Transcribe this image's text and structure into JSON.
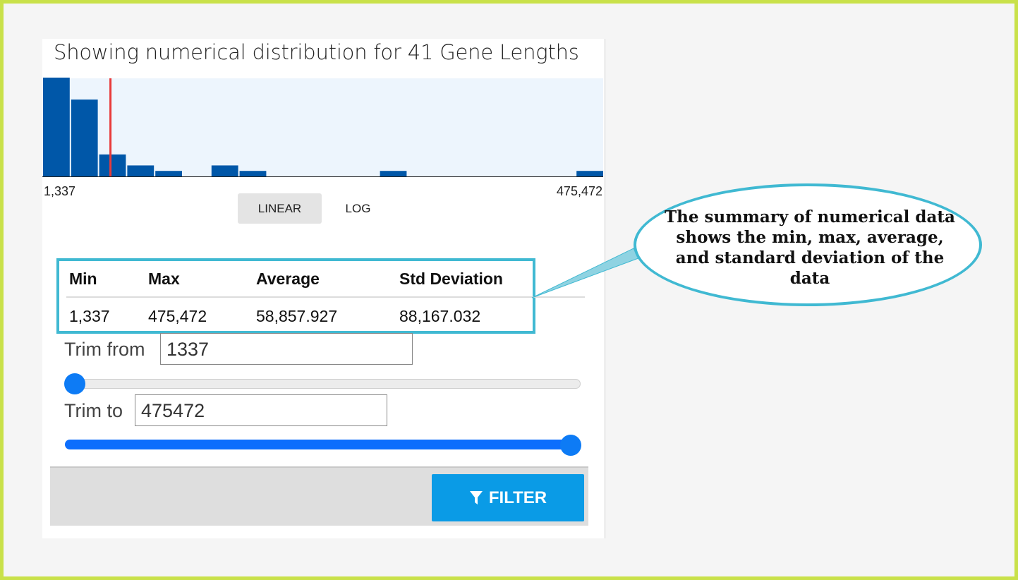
{
  "title": "Showing numerical distribution for 41 Gene Lengths",
  "chart_data": {
    "type": "bar",
    "title": "Showing numerical distribution for 41 Gene Lengths",
    "x_range": [
      1337,
      475472
    ],
    "x_min_label": "1,337",
    "x_max_label": "475,472",
    "bins": 20,
    "counts": [
      18,
      14,
      4,
      2,
      1,
      0,
      2,
      1,
      0,
      0,
      0,
      0,
      1,
      0,
      0,
      0,
      0,
      0,
      0,
      1
    ],
    "marker_value": 58857.927,
    "marker_label": "Average",
    "scale": "linear",
    "colors": {
      "bar": "#0057a8",
      "background": "#edf5fd",
      "marker": "#e83a3a"
    }
  },
  "scale_toggle": {
    "linear_label": "LINEAR",
    "log_label": "LOG",
    "selected": "LINEAR"
  },
  "stats": {
    "headers": {
      "min": "Min",
      "max": "Max",
      "average": "Average",
      "std": "Std Deviation"
    },
    "values": {
      "min": "1,337",
      "max": "475,472",
      "average": "58,857.927",
      "std": "88,167.032"
    }
  },
  "trim": {
    "from_label": "Trim from",
    "from_value": "1337",
    "to_label": "Trim to",
    "to_value": "475472",
    "from_slider_fraction": 0.0,
    "to_slider_fraction": 1.0
  },
  "filter_button": {
    "label": "FILTER",
    "icon": "filter-icon",
    "color": "#0a9be6"
  },
  "annotation": {
    "text": "The summary of numerical data shows the min, max, average, and standard deviation of the data",
    "color": "#40b9d2"
  }
}
